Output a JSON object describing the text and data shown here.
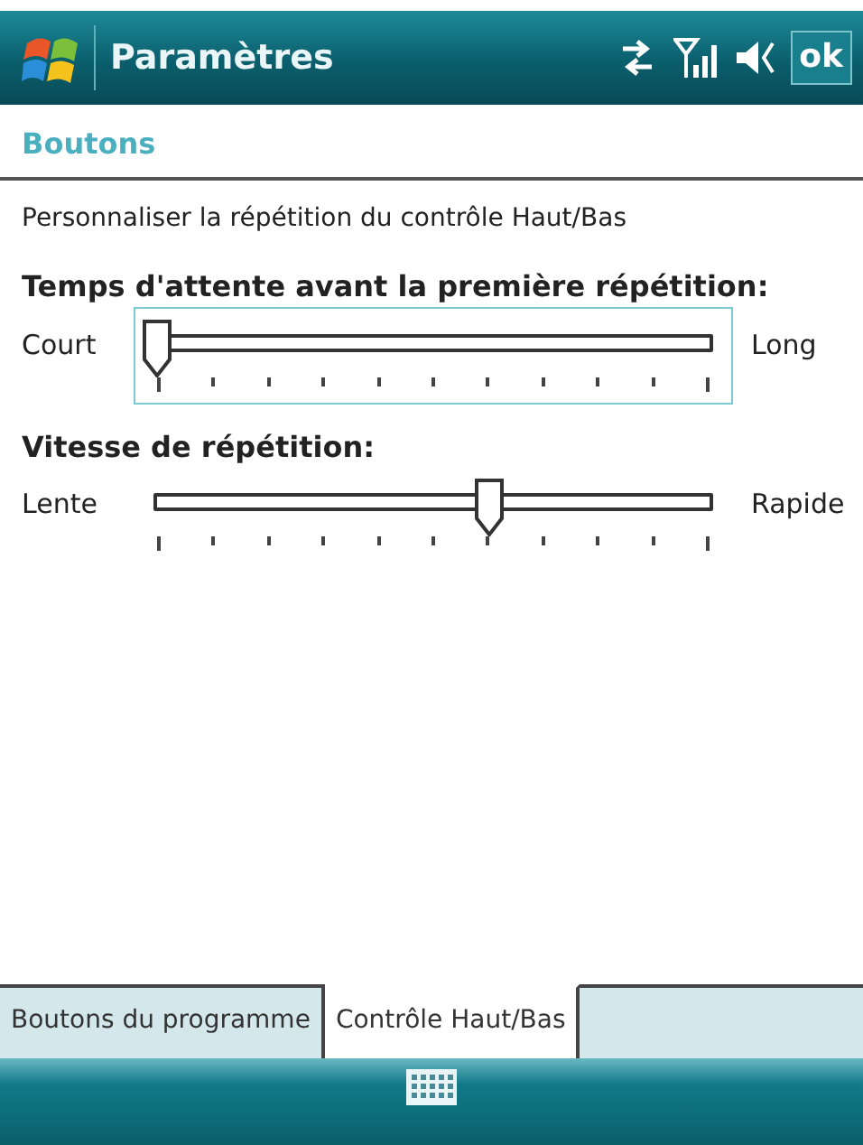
{
  "title_bar": {
    "title": "Paramètres",
    "ok_button": "ok"
  },
  "page_header": "Boutons",
  "description": "Personnaliser la répétition du contrôle Haut/Bas",
  "sliders": [
    {
      "label": "Temps d'attente avant la première répétition:",
      "min_label": "Court",
      "max_label": "Long",
      "level": 0,
      "focused": true
    },
    {
      "label": "Vitesse de répétition:",
      "min_label": "Lente",
      "max_label": "Rapide",
      "level": 0.6,
      "focused": false
    }
  ],
  "tabs": [
    {
      "label": "Boutons du programme",
      "selected": false
    },
    {
      "label": "Contrôle Haut/Bas",
      "selected": true
    }
  ]
}
